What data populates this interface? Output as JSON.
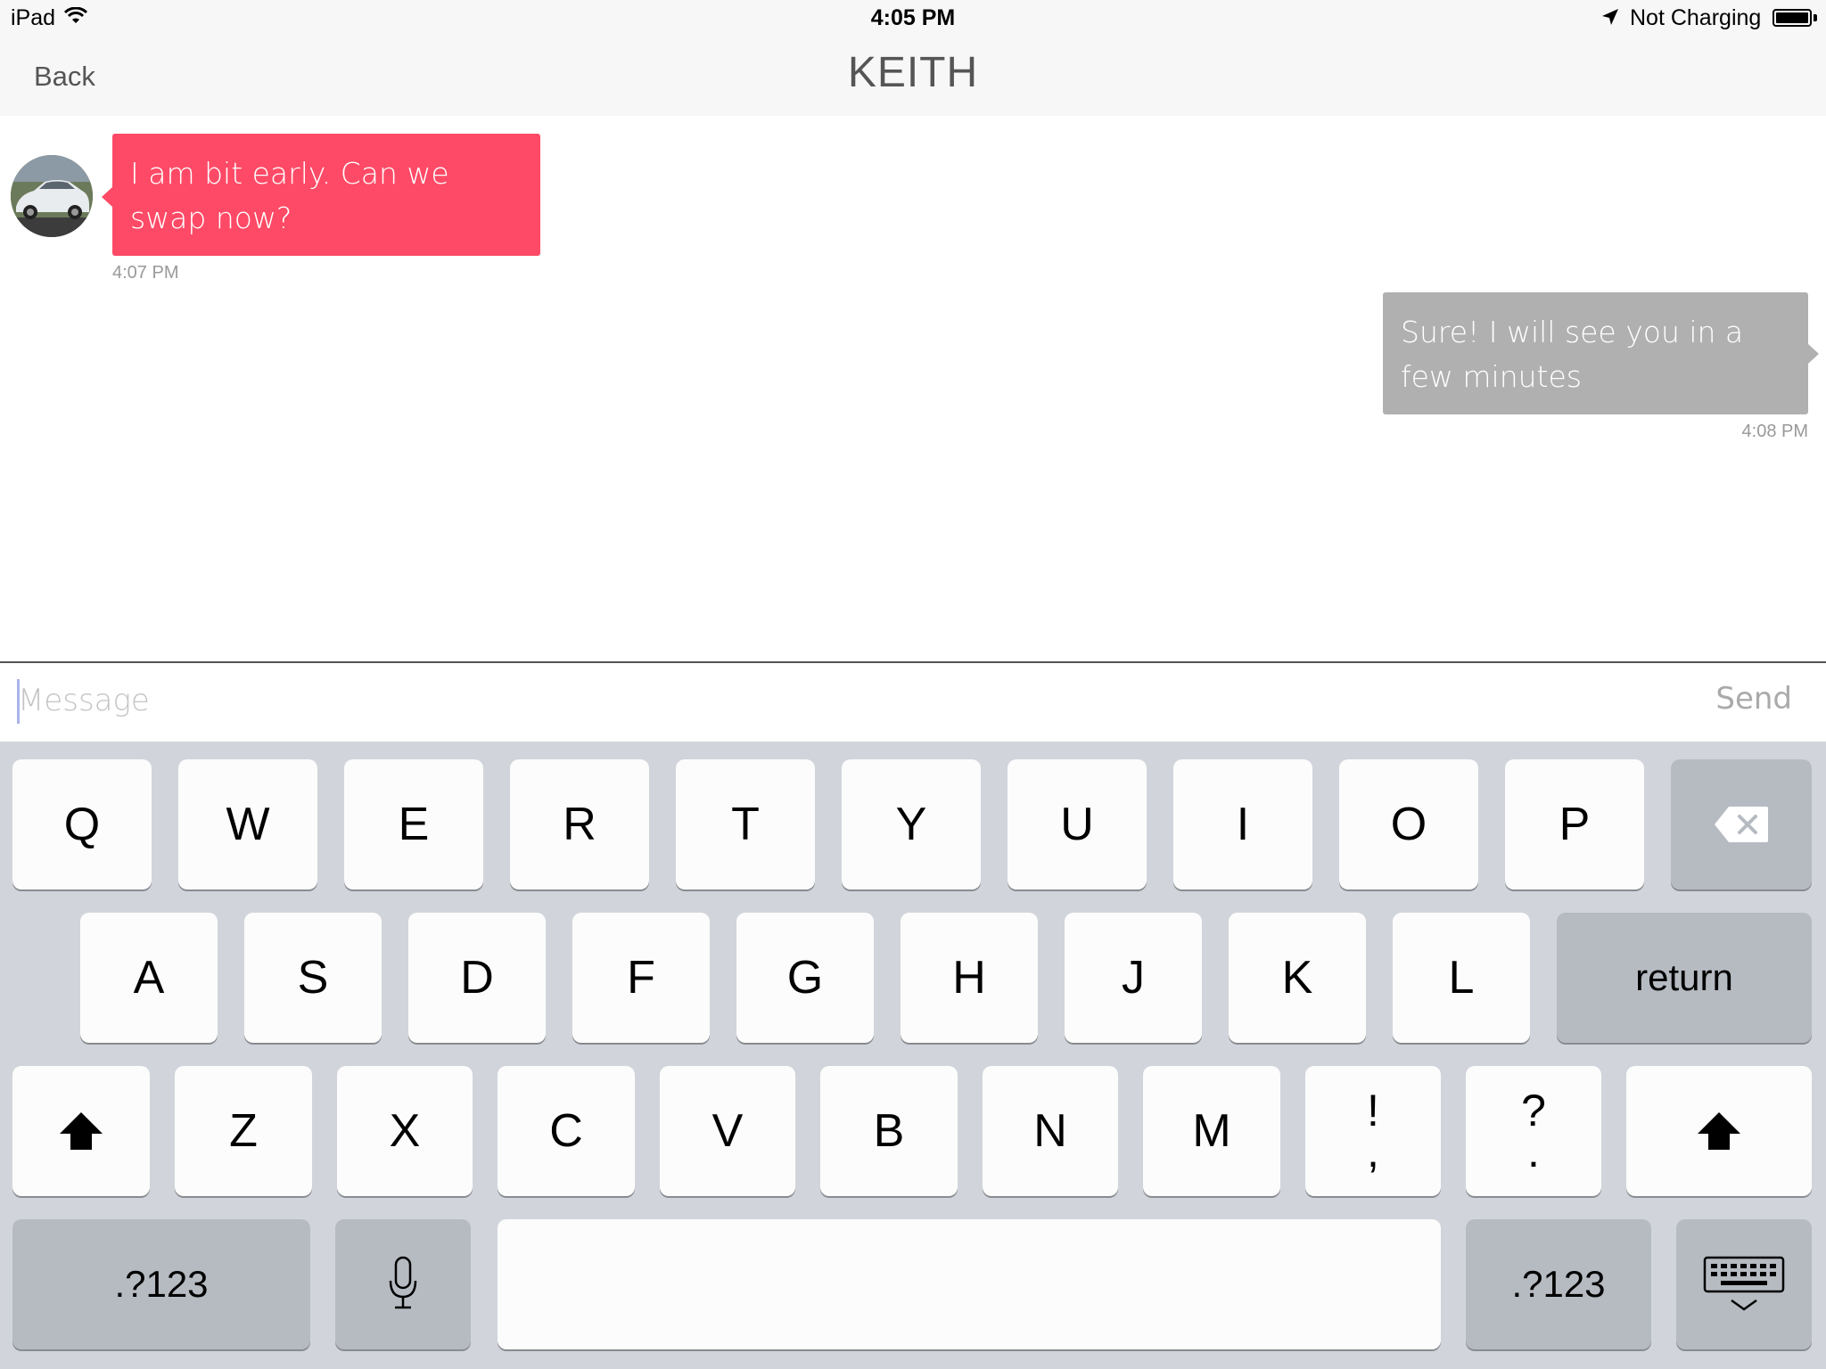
{
  "status_bar": {
    "device": "iPad",
    "time": "4:05 PM",
    "charging": "Not Charging"
  },
  "nav": {
    "back_label": "Back",
    "title": "KEITH"
  },
  "messages": [
    {
      "direction": "incoming",
      "text": "I am bit early. Can we swap now?",
      "time": "4:07 PM",
      "bubble_color": "#fe4a66"
    },
    {
      "direction": "outgoing",
      "text": "Sure! I will see you in a few minutes",
      "time": "4:08 PM",
      "bubble_color": "#b0b0b0"
    }
  ],
  "composer": {
    "placeholder": "Message",
    "send_label": "Send"
  },
  "keyboard": {
    "row1": [
      "Q",
      "W",
      "E",
      "R",
      "T",
      "Y",
      "U",
      "I",
      "O",
      "P"
    ],
    "row2": [
      "A",
      "S",
      "D",
      "F",
      "G",
      "H",
      "J",
      "K",
      "L"
    ],
    "return_label": "return",
    "row3": [
      "Z",
      "X",
      "C",
      "V",
      "B",
      "N",
      "M"
    ],
    "punct1": [
      "!",
      ","
    ],
    "punct2": [
      "?",
      "."
    ],
    "numbers_label": ".?123"
  }
}
